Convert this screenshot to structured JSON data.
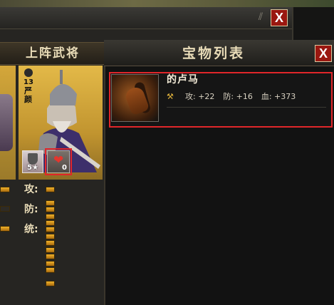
{
  "back_panel": {
    "section_header": "上阵武将",
    "close_icon": "X"
  },
  "hero": {
    "level": "13",
    "name": "严颜",
    "stars": "5★",
    "treasure_count": "0"
  },
  "stats": [
    {
      "label": "攻:",
      "filled": 5
    },
    {
      "label": "防:",
      "filled": 5
    },
    {
      "label": "统:",
      "filled": 5
    }
  ],
  "treasure_panel": {
    "title": "宝物列表",
    "close_icon": "X",
    "items": [
      {
        "name": "的卢马",
        "attack": "攻: +22",
        "defense": "防: +16",
        "hp": "血: +373"
      }
    ]
  },
  "colors": {
    "highlight": "#e0262a",
    "bar_fill": "#f0b22a",
    "close_button": "#9a1710"
  }
}
